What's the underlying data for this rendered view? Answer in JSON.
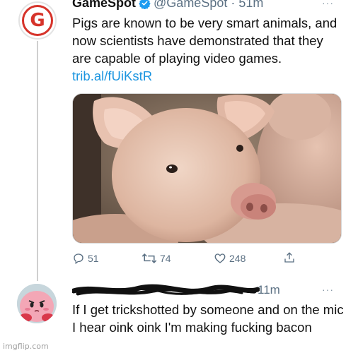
{
  "tweet1": {
    "avatar_letter": "G",
    "name": "GameSpot",
    "handle_time": "@GameSpot · 51m",
    "text": "Pigs are known to be very smart animals, and now scientists have demonstrated that they are capable of playing video games.",
    "link": "trib.al/fUiKstR",
    "more": "···",
    "stats": {
      "replies": "51",
      "retweets": "74",
      "likes": "248"
    }
  },
  "tweet2": {
    "time": "11m",
    "more": "···",
    "text": "If I get trickshotted by someone and on the mic I hear oink oink I'm making fucking bacon"
  },
  "watermark": "imgflip.com",
  "colors": {
    "gamespot_red": "#d6332a",
    "verified_blue": "#1d9bf0",
    "link_blue": "#1b95e0",
    "muted_gray": "#5b7083"
  }
}
